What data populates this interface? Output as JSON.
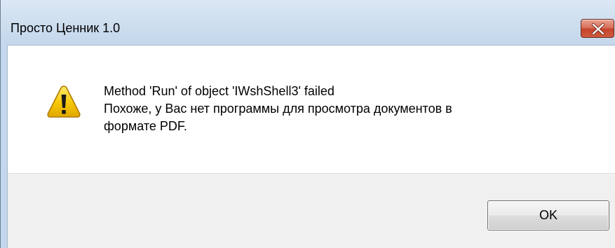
{
  "window": {
    "title": "Просто Ценник 1.0"
  },
  "titlebar": {
    "close_icon": "close-x-icon"
  },
  "dialog": {
    "icon": "warning-triangle-icon",
    "message_lines": [
      "Method 'Run' of object 'IWshShell3' failed",
      "Похоже, у Вас нет программы для просмотра документов в",
      "формате PDF."
    ]
  },
  "buttons": {
    "ok_label": "OK"
  },
  "colors": {
    "frame": "#c4d7ec",
    "close_button": "#c4432b",
    "footer": "#f0f0f0",
    "warning_fill": "#f5c400"
  }
}
